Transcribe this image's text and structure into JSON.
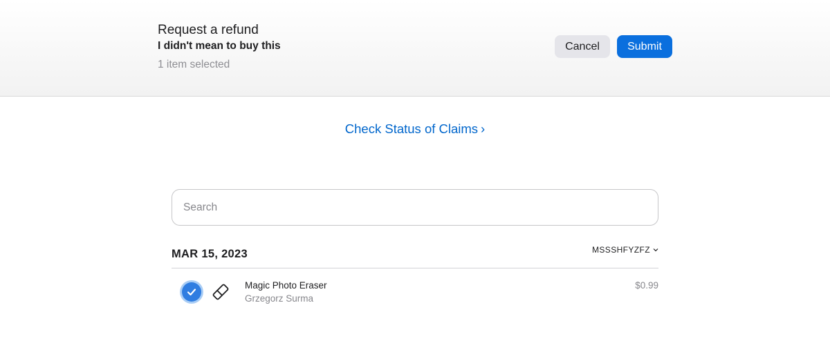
{
  "header": {
    "title": "Request a refund",
    "reason": "I didn't mean to buy this",
    "selection_count": "1 item selected",
    "cancel_label": "Cancel",
    "submit_label": "Submit"
  },
  "claims_link": {
    "label": "Check Status of Claims",
    "chevron": "›"
  },
  "search": {
    "placeholder": "Search",
    "value": ""
  },
  "order": {
    "date": "MAR 15, 2023",
    "order_id": "MSSSHFYZFZ",
    "chevron": "⌄",
    "items": [
      {
        "name": "Magic Photo Eraser",
        "developer": "Grzegorz Surma",
        "price": "$0.99",
        "selected": true,
        "icon": "eraser-icon"
      }
    ]
  },
  "colors": {
    "accent": "#0a6fde",
    "link": "#0066cc",
    "checkbox": "#2f7de1"
  }
}
